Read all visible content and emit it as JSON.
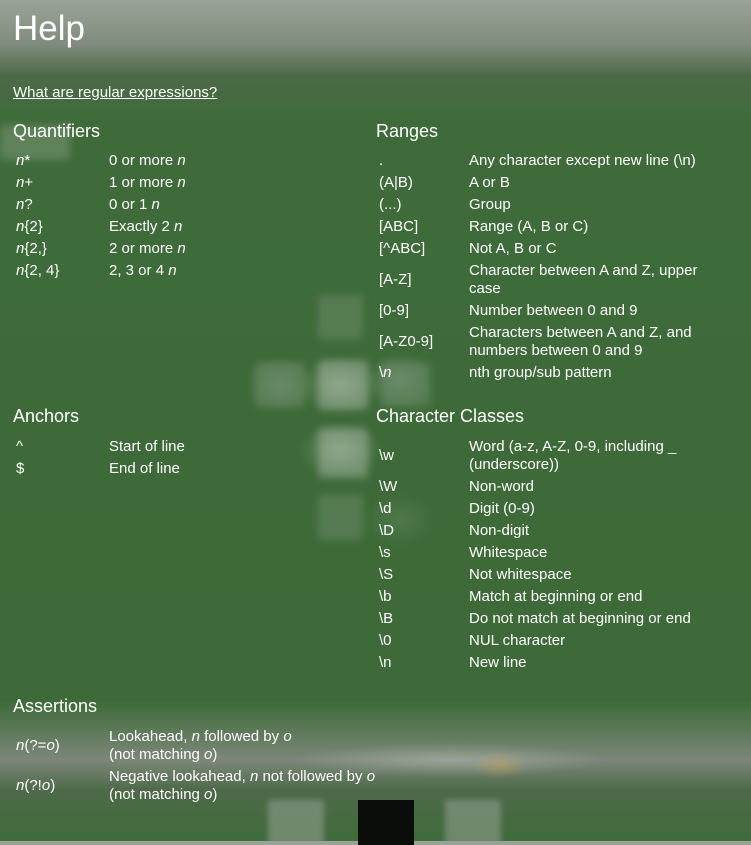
{
  "title": "Help",
  "intro_link": "What are regular expressions?",
  "quantifiers": {
    "heading": "Quantifiers",
    "rows": [
      {
        "key_pre": "",
        "key_it": "n",
        "key_post": "*",
        "desc": "0 or more ",
        "desc_it": "n"
      },
      {
        "key_pre": "",
        "key_it": "n",
        "key_post": "+",
        "desc": "1 or more ",
        "desc_it": "n"
      },
      {
        "key_pre": "",
        "key_it": "n",
        "key_post": "?",
        "desc": "0 or 1 ",
        "desc_it": "n"
      },
      {
        "key_pre": "",
        "key_it": "n",
        "key_post": "{2}",
        "desc": "Exactly 2 ",
        "desc_it": "n"
      },
      {
        "key_pre": "",
        "key_it": "n",
        "key_post": "{2,}",
        "desc": "2 or more ",
        "desc_it": "n"
      },
      {
        "key_pre": "",
        "key_it": "n",
        "key_post": "{2, 4}",
        "desc": "2, 3 or 4 ",
        "desc_it": "n"
      }
    ]
  },
  "ranges": {
    "heading": "Ranges",
    "rows": [
      {
        "key": ".",
        "desc": "Any character except new line (\\n)"
      },
      {
        "key": "(A|B)",
        "desc": "A or B"
      },
      {
        "key": "(...)",
        "desc": "Group"
      },
      {
        "key": "[ABC]",
        "desc": "Range (A, B or C)"
      },
      {
        "key": "[^ABC]",
        "desc": "Not A, B or C"
      },
      {
        "key": "[A-Z]",
        "desc": "Character between A and Z, upper case"
      },
      {
        "key": "[0-9]",
        "desc": "Number between 0 and 9"
      },
      {
        "key": "[A-Z0-9]",
        "desc": "Characters between A and Z, and numbers between 0 and 9"
      },
      {
        "key": "\\",
        "key_it": "n",
        "desc": "nth group/sub pattern"
      }
    ]
  },
  "anchors": {
    "heading": "Anchors",
    "rows": [
      {
        "key": "^",
        "desc": "Start of line"
      },
      {
        "key": "$",
        "desc": "End of line"
      }
    ]
  },
  "character_classes": {
    "heading": "Character Classes",
    "rows": [
      {
        "key": "\\w",
        "desc": "Word (a-z, A-Z, 0-9, including _ (underscore))"
      },
      {
        "key": "\\W",
        "desc": "Non-word"
      },
      {
        "key": "\\d",
        "desc": "Digit (0-9)"
      },
      {
        "key": "\\D",
        "desc": "Non-digit"
      },
      {
        "key": "\\s",
        "desc": "Whitespace"
      },
      {
        "key": "\\S",
        "desc": "Not whitespace"
      },
      {
        "key": "\\b",
        "desc": "Match at beginning or end"
      },
      {
        "key": "\\B",
        "desc": "Do not match at beginning or end"
      },
      {
        "key": "\\0",
        "desc": "NUL character"
      },
      {
        "key": "\\n",
        "desc": "New line"
      }
    ]
  },
  "assertions": {
    "heading": "Assertions",
    "rows": [
      {
        "key_a": "n",
        "key_b": "(?=",
        "key_c": "o",
        "key_d": ")",
        "d1": "Lookahead, ",
        "d2": "n",
        "d3": " followed by ",
        "d4": "o",
        "d5": "(not matching ",
        "d6": "o",
        "d7": ")"
      },
      {
        "key_a": "n",
        "key_b": "(?!",
        "key_c": "o",
        "key_d": ")",
        "d1": "Negative lookahead, ",
        "d2": "n",
        "d3": " not followed by ",
        "d4": "o",
        "d5": "(not matching ",
        "d6": "o",
        "d7": ")"
      }
    ]
  }
}
